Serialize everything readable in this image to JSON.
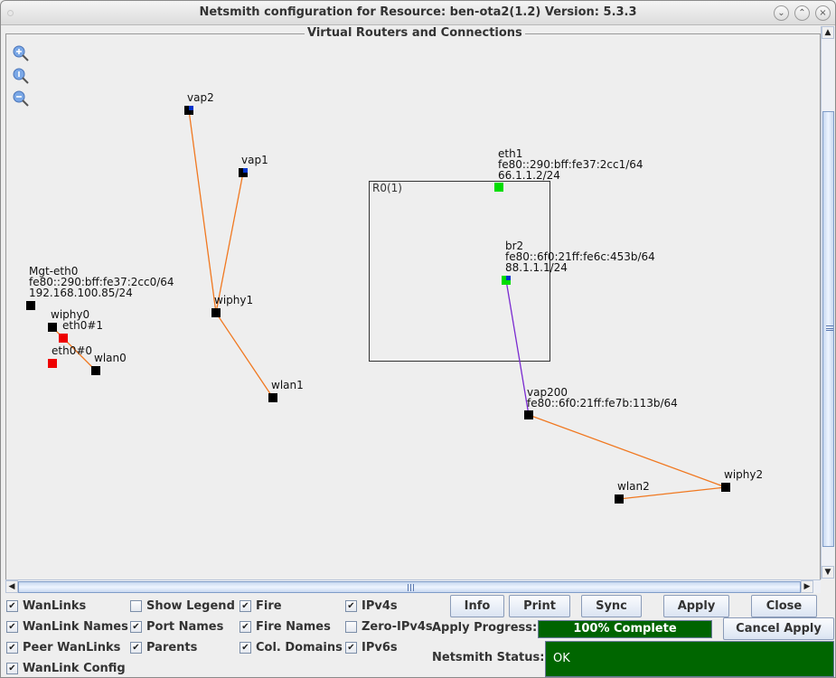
{
  "window": {
    "title": "Netsmith configuration for Resource:  ben-ota2(1.2)  Version: 5.3.3",
    "controls": [
      "minimize",
      "maximize",
      "close"
    ]
  },
  "panel": {
    "title": "Virtual Routers and Connections"
  },
  "zoom_controls": [
    {
      "name": "zoom-in-icon",
      "glyph": "+"
    },
    {
      "name": "zoom-reset-icon",
      "glyph": "1"
    },
    {
      "name": "zoom-out-icon",
      "glyph": "−"
    }
  ],
  "topology": {
    "router": {
      "label": "R0(1)"
    },
    "ports": [
      {
        "id": "vap2",
        "lines": [
          "vap2"
        ],
        "color": "#000000",
        "badge": "#0033cc"
      },
      {
        "id": "vap1",
        "lines": [
          "vap1"
        ],
        "color": "#000000",
        "badge": "#0033cc"
      },
      {
        "id": "wiphy1",
        "lines": [
          "wiphy1"
        ],
        "color": "#000000",
        "badge": ""
      },
      {
        "id": "wlan1",
        "lines": [
          "wlan1"
        ],
        "color": "#000000",
        "badge": ""
      },
      {
        "id": "mgt-eth0",
        "lines": [
          "Mgt-eth0",
          "fe80::290:bff:fe37:2cc0/64",
          "192.168.100.85/24"
        ],
        "color": "#000000",
        "badge": ""
      },
      {
        "id": "wiphy0",
        "lines": [
          "wiphy0"
        ],
        "color": "#000000",
        "badge": ""
      },
      {
        "id": "eth0-1",
        "lines": [
          "eth0#1"
        ],
        "color": "#ee0000",
        "badge": ""
      },
      {
        "id": "eth0-0",
        "lines": [
          "eth0#0"
        ],
        "color": "#ee0000",
        "badge": ""
      },
      {
        "id": "wlan0",
        "lines": [
          "wlan0"
        ],
        "color": "#000000",
        "badge": ""
      },
      {
        "id": "eth1",
        "lines": [
          "eth1",
          "fe80::290:bff:fe37:2cc1/64",
          "66.1.1.2/24"
        ],
        "color": "#00dd00",
        "badge": ""
      },
      {
        "id": "br2",
        "lines": [
          "br2",
          "fe80::6f0:21ff:fe6c:453b/64",
          "88.1.1.1/24"
        ],
        "color": "#00dd00",
        "badge": "#0033cc"
      },
      {
        "id": "vap200",
        "lines": [
          "vap200",
          "fe80::6f0:21ff:fe7b:113b/64"
        ],
        "color": "#000000",
        "badge": ""
      },
      {
        "id": "wiphy2",
        "lines": [
          "wiphy2"
        ],
        "color": "#000000",
        "badge": ""
      },
      {
        "id": "wlan2",
        "lines": [
          "wlan2"
        ],
        "color": "#000000",
        "badge": ""
      }
    ],
    "links": [
      {
        "from": "vap2",
        "to": "wiphy1",
        "color": "#f07820"
      },
      {
        "from": "vap1",
        "to": "wiphy1",
        "color": "#f07820"
      },
      {
        "from": "wiphy1",
        "to": "wlan1",
        "color": "#f07820"
      },
      {
        "from": "wiphy0",
        "to": "wlan0",
        "color": "#f07820"
      },
      {
        "from": "br2",
        "to": "vap200",
        "color": "#7a2ad0"
      },
      {
        "from": "vap200",
        "to": "wiphy2",
        "color": "#f07820"
      },
      {
        "from": "wiphy2",
        "to": "wlan2",
        "color": "#f07820"
      }
    ]
  },
  "options": [
    {
      "label": "WanLinks",
      "checked": true
    },
    {
      "label": "WanLink Names",
      "checked": true
    },
    {
      "label": "Peer WanLinks",
      "checked": true
    },
    {
      "label": "WanLink Config",
      "checked": true
    },
    {
      "label": "Show Legend",
      "checked": false
    },
    {
      "label": "Port Names",
      "checked": true
    },
    {
      "label": "Parents",
      "checked": true
    },
    {
      "label": "Fire",
      "checked": true
    },
    {
      "label": "Fire Names",
      "checked": true
    },
    {
      "label": "Col. Domains",
      "checked": true
    },
    {
      "label": "IPv4s",
      "checked": true
    },
    {
      "label": "Zero-IPv4s",
      "checked": false
    },
    {
      "label": "IPv6s",
      "checked": true
    }
  ],
  "buttons": {
    "info": "Info",
    "print": "Print",
    "sync": "Sync",
    "apply": "Apply",
    "close": "Close",
    "cancel_apply": "Cancel Apply"
  },
  "apply_progress": {
    "label": "Apply Progress:",
    "text": "100% Complete",
    "percent": 100,
    "color": "#006400"
  },
  "netsmith_status": {
    "label": "Netsmith Status:",
    "value": "OK",
    "color": "#006600"
  }
}
